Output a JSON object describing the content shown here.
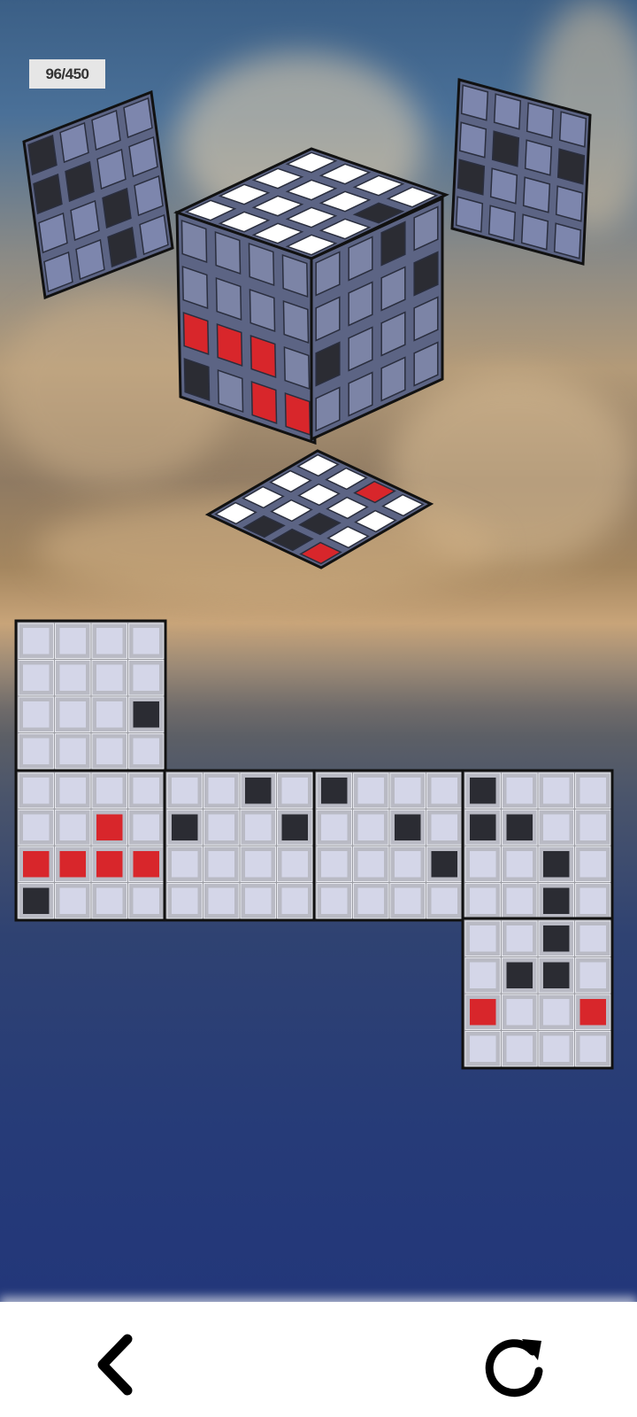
{
  "hud": {
    "score": "96/450"
  },
  "colors": {
    "light": "#d4d6e8",
    "dark": "#2b2c33",
    "red": "#d8262b",
    "frame": "#9a9ba2",
    "border": "#111111",
    "cube_side": "#7c84a6",
    "cube_top": "#ffffff"
  },
  "puzzle": {
    "front": [
      [
        "L",
        "L",
        "L",
        "L"
      ],
      [
        "L",
        "L",
        "L",
        "L"
      ],
      [
        "L",
        "L",
        "L",
        "D"
      ],
      [
        "L",
        "L",
        "L",
        "L"
      ]
    ],
    "faces_row": [
      [
        [
          "L",
          "L",
          "L",
          "L"
        ],
        [
          "L",
          "L",
          "R",
          "L"
        ],
        [
          "R",
          "R",
          "R",
          "R"
        ],
        [
          "D",
          "L",
          "L",
          "L"
        ]
      ],
      [
        [
          "L",
          "L",
          "D",
          "L"
        ],
        [
          "D",
          "L",
          "L",
          "D"
        ],
        [
          "L",
          "L",
          "L",
          "L"
        ],
        [
          "L",
          "L",
          "L",
          "L"
        ]
      ],
      [
        [
          "D",
          "L",
          "L",
          "L"
        ],
        [
          "L",
          "L",
          "D",
          "L"
        ],
        [
          "L",
          "L",
          "L",
          "D"
        ],
        [
          "L",
          "L",
          "L",
          "L"
        ]
      ],
      [
        [
          "D",
          "L",
          "L",
          "L"
        ],
        [
          "D",
          "D",
          "L",
          "L"
        ],
        [
          "L",
          "L",
          "D",
          "L"
        ],
        [
          "L",
          "L",
          "D",
          "L"
        ]
      ]
    ],
    "bottom": [
      [
        "L",
        "L",
        "D",
        "L"
      ],
      [
        "L",
        "D",
        "D",
        "L"
      ],
      [
        "R",
        "L",
        "L",
        "R"
      ],
      [
        "L",
        "L",
        "L",
        "L"
      ]
    ],
    "cube_left_face": [
      [
        "L",
        "L",
        "L",
        "L"
      ],
      [
        "L",
        "L",
        "L",
        "L"
      ],
      [
        "R",
        "R",
        "R",
        "L"
      ],
      [
        "D",
        "L",
        "R",
        "R"
      ]
    ],
    "cube_right_face": [
      [
        "L",
        "L",
        "D",
        "L"
      ],
      [
        "L",
        "L",
        "L",
        "D"
      ],
      [
        "D",
        "L",
        "L",
        "L"
      ],
      [
        "L",
        "L",
        "L",
        "L"
      ]
    ],
    "cube_top_face": [
      [
        "L",
        "L",
        "L",
        "L"
      ],
      [
        "L",
        "L",
        "L",
        "L"
      ],
      [
        "L",
        "L",
        "L",
        "L"
      ],
      [
        "L",
        "L",
        "D",
        "L"
      ]
    ],
    "floating_left_panel": [
      [
        "D",
        "L",
        "L",
        "L"
      ],
      [
        "D",
        "D",
        "L",
        "L"
      ],
      [
        "L",
        "L",
        "D",
        "L"
      ],
      [
        "L",
        "L",
        "D",
        "L"
      ]
    ],
    "floating_right_panel": [
      [
        "L",
        "L",
        "L",
        "L"
      ],
      [
        "L",
        "D",
        "L",
        "D"
      ],
      [
        "D",
        "L",
        "L",
        "L"
      ],
      [
        "L",
        "L",
        "L",
        "L"
      ]
    ],
    "floor_tile": [
      [
        "L",
        "L",
        "L",
        "L"
      ],
      [
        "D",
        "L",
        "L",
        "L"
      ],
      [
        "D",
        "D",
        "L",
        "R"
      ],
      [
        "R",
        "L",
        "L",
        "L"
      ]
    ]
  },
  "icons": {
    "back": "chevron-left-icon",
    "restart": "restart-icon"
  }
}
